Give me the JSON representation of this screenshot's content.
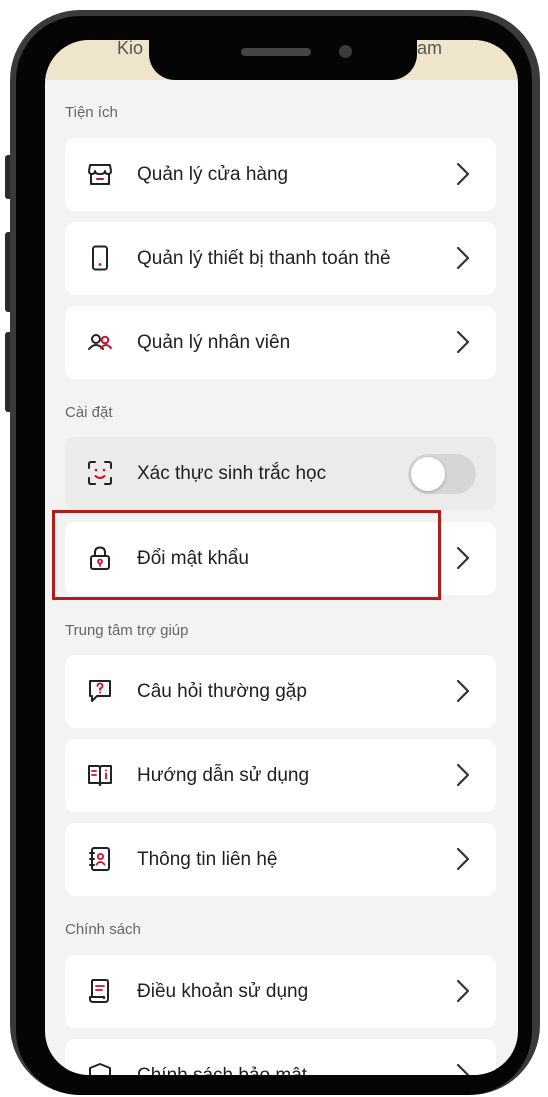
{
  "topbar": {
    "left_text": "Kio",
    "right_text": "am"
  },
  "sections": {
    "utilities": {
      "label": "Tiện ích",
      "items": [
        {
          "label": "Quản lý cửa hàng",
          "icon": "store-icon"
        },
        {
          "label": "Quản lý thiết bị thanh toán thẻ",
          "icon": "card-terminal-icon"
        },
        {
          "label": "Quản lý nhân viên",
          "icon": "staff-icon"
        }
      ]
    },
    "settings": {
      "label": "Cài đặt",
      "items": [
        {
          "label": "Xác thực sinh trắc học",
          "icon": "face-id-icon",
          "toggle": false
        },
        {
          "label": "Đổi mật khẩu",
          "icon": "lock-icon"
        }
      ]
    },
    "help": {
      "label": "Trung tâm trợ giúp",
      "items": [
        {
          "label": "Câu hỏi thường gặp",
          "icon": "faq-icon"
        },
        {
          "label": "Hướng dẫn sử dụng",
          "icon": "guide-icon"
        },
        {
          "label": "Thông tin liên hệ",
          "icon": "contact-icon"
        }
      ]
    },
    "policy": {
      "label": "Chính sách",
      "items": [
        {
          "label": "Điều khoản sử dụng",
          "icon": "terms-icon"
        },
        {
          "label": "Chính sách bảo mật",
          "icon": "shield-icon"
        }
      ]
    }
  },
  "colors": {
    "accent": "#c8102e",
    "highlight": "#b01c1c"
  }
}
